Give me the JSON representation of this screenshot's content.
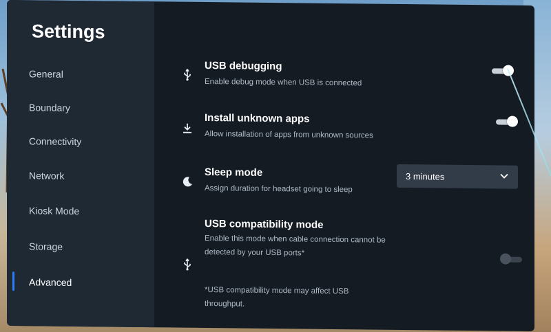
{
  "sidebar": {
    "title": "Settings",
    "items": [
      {
        "label": "General"
      },
      {
        "label": "Boundary"
      },
      {
        "label": "Connectivity"
      },
      {
        "label": "Network"
      },
      {
        "label": "Kiosk Mode"
      },
      {
        "label": "Storage"
      },
      {
        "label": "Advanced"
      }
    ],
    "active": "Advanced"
  },
  "settings": {
    "usb_debugging": {
      "title": "USB debugging",
      "desc": "Enable debug mode when USB is connected",
      "icon": "usb-icon",
      "enabled": true
    },
    "install_unknown": {
      "title": "Install unknown apps",
      "desc": "Allow installation of apps from unknown sources",
      "icon": "download-icon",
      "enabled": true
    },
    "sleep_mode": {
      "title": "Sleep mode",
      "desc": "Assign duration for headset going to sleep",
      "icon": "moon-icon",
      "value": "3 minutes"
    },
    "usb_compat": {
      "title": "USB compatibility mode",
      "desc_line1": "Enable this mode when cable connection cannot be",
      "desc_line2": "detected by your USB ports*",
      "note_line1": "*USB compatibility mode may affect USB",
      "note_line2": "throughput.",
      "icon": "usb-icon",
      "enabled": false
    }
  },
  "colors": {
    "accent": "#2e7cf6",
    "panel": "#141b23",
    "sidebar": "#1f2934"
  }
}
